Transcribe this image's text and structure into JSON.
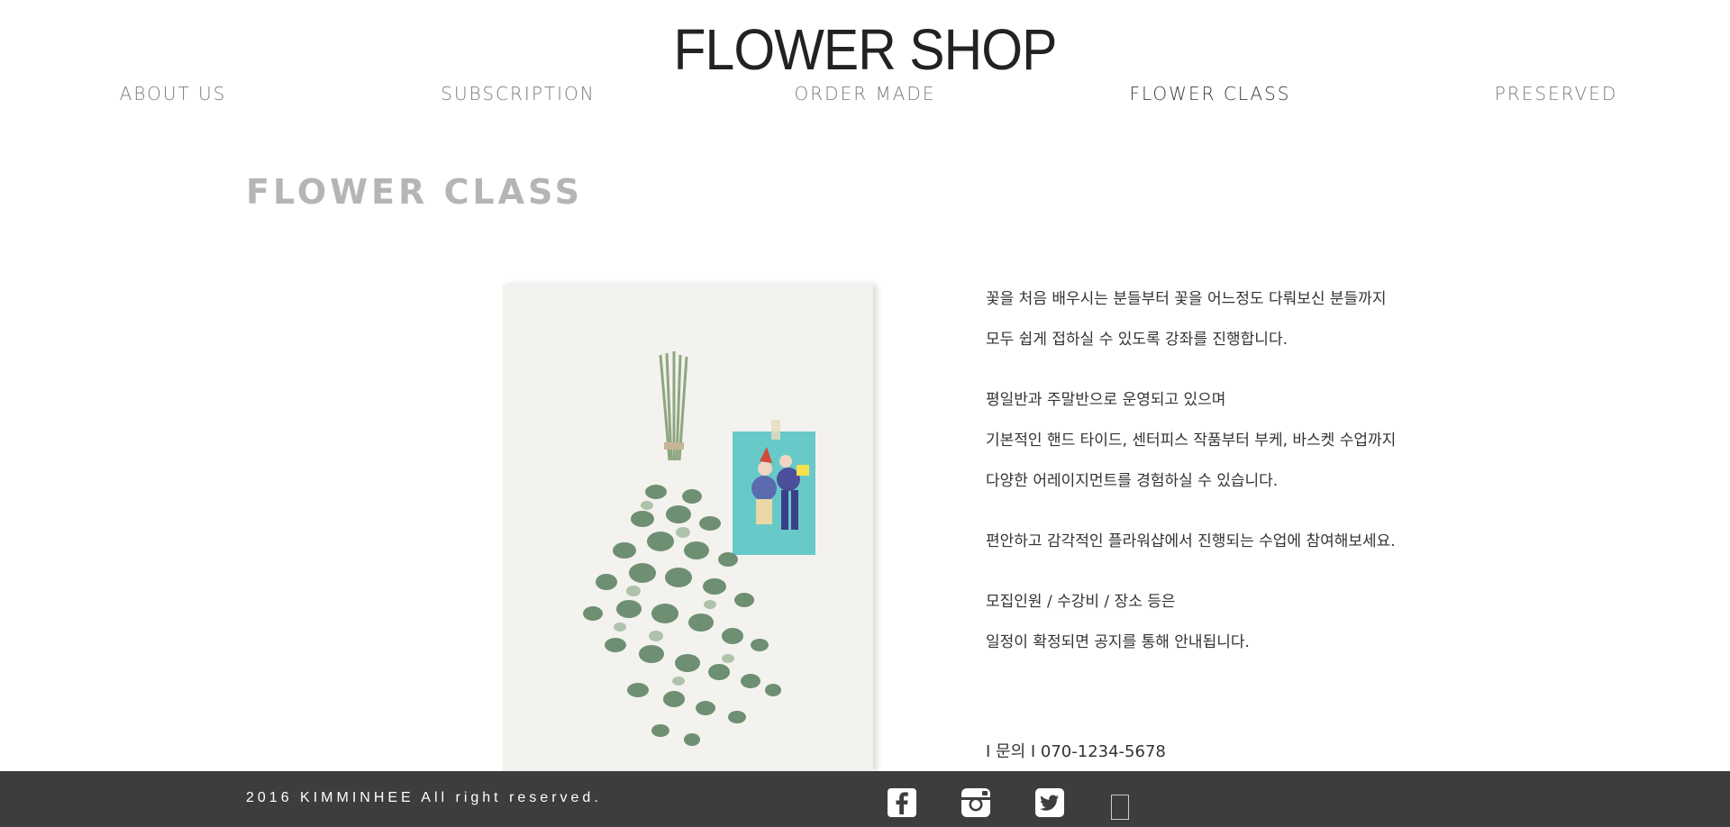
{
  "site": {
    "title": "FLOWER SHOP"
  },
  "nav": {
    "items": [
      {
        "label": "ABOUT US"
      },
      {
        "label": "SUBSCRIPTION"
      },
      {
        "label": "ORDER MADE"
      },
      {
        "label": "FLOWER CLASS",
        "active": true
      },
      {
        "label": "PRESERVED"
      }
    ]
  },
  "page": {
    "title": "FLOWER CLASS",
    "paragraphs": [
      [
        "꽃을 처음 배우시는 분들부터 꽃을 어느정도 다뤄보신 분들까지",
        "모두 쉽게 접하실 수 있도록 강좌를 진행합니다."
      ],
      [
        "평일반과 주말반으로 운영되고 있으며",
        "기본적인 핸드 타이드, 센터피스 작품부터 부케, 바스켓 수업까지",
        "다양한 어레이지먼트를 경험하실 수 있습니다."
      ],
      [
        "편안하고 감각적인 플라워샵에서 진행되는 수업에 참여해보세요."
      ],
      [
        "모집인원 / 수강비 / 장소 등은",
        "일정이 확정되면 공지를 통해 안내됩니다."
      ]
    ],
    "contact": "I 문의 I 070-1234-5678"
  },
  "footer": {
    "copyright": "2016 KIMMINHEE All right reserved.",
    "social": [
      "facebook-icon",
      "instagram-icon",
      "twitter-icon"
    ]
  },
  "colors": {
    "footer_bg": "#3d3d3d",
    "title_gray": "#b5b5b5",
    "nav_gray": "#7a7a7a"
  }
}
